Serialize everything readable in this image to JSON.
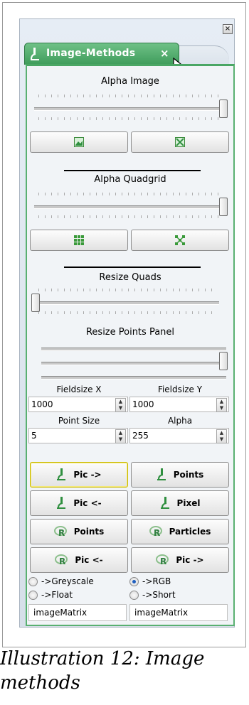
{
  "window": {
    "close_glyph": "×",
    "tab_title": "Image-Methods",
    "tab_close_glyph": "×"
  },
  "alpha_image": {
    "label": "Alpha Image",
    "slider_value": 1.0
  },
  "alpha_quadgrid": {
    "label": "Alpha Quadgrid",
    "slider_value": 1.0
  },
  "resize_quads": {
    "label": "Resize Quads",
    "slider_value": 0.0
  },
  "resize_points_panel": {
    "label": "Resize Points Panel",
    "slider_value": 1.0
  },
  "fields": {
    "fieldsize_x_label": "Fieldsize X",
    "fieldsize_x_value": "1000",
    "fieldsize_y_label": "Fieldsize Y",
    "fieldsize_y_value": "1000",
    "point_size_label": "Point Size",
    "point_size_value": "5",
    "alpha_label": "Alpha",
    "alpha_value": "255"
  },
  "buttons": {
    "pic_to": "Pic ->",
    "points": "Points",
    "pic_from": "Pic <-",
    "pixel": "Pixel",
    "r_points": "Points",
    "r_particles": "Particles",
    "r_pic_from": "Pic <-",
    "r_pic_to": "Pic ->"
  },
  "radios": {
    "greyscale": "->Greyscale",
    "rgb": "->RGB",
    "float": "->Float",
    "short": "->Short",
    "selected": "rgb"
  },
  "outputs": {
    "left": "imageMatrix",
    "right": "imageMatrix"
  },
  "caption": {
    "line1": "Illustration 12: Image",
    "line2": "methods"
  },
  "colors": {
    "accent_green": "#4aa664",
    "tab_green": "#3f9c5b"
  }
}
